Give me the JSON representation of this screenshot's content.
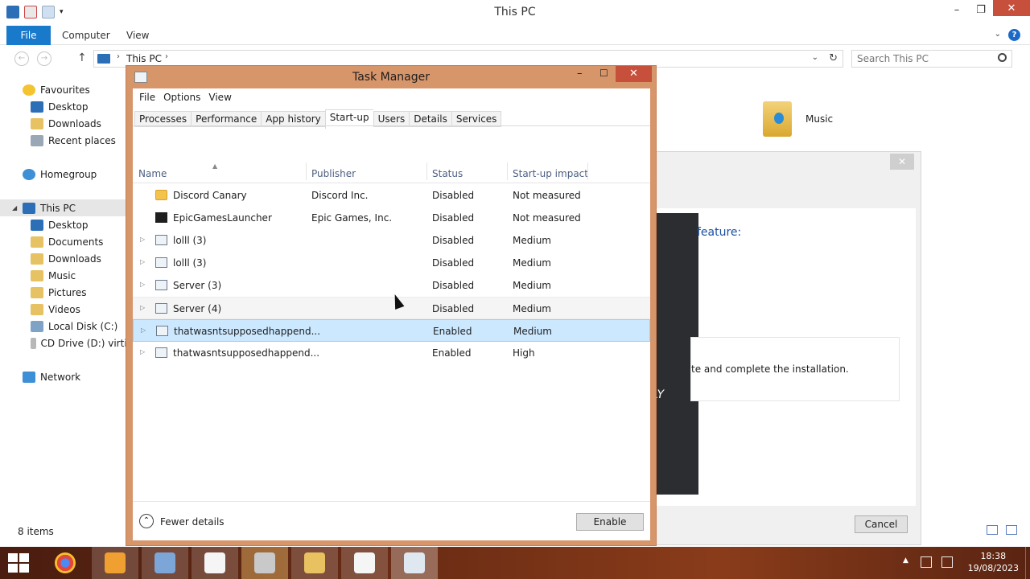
{
  "explorer": {
    "title": "This PC",
    "ribbon_tabs": [
      "File",
      "Computer",
      "View"
    ],
    "address": {
      "crumb": "This PC"
    },
    "search": {
      "placeholder": "Search This PC"
    },
    "status": "8 items",
    "nav": {
      "favourites": "Favourites",
      "fav_items": [
        "Desktop",
        "Downloads",
        "Recent places"
      ],
      "homegroup": "Homegroup",
      "this_pc": "This PC",
      "pc_items": [
        "Desktop",
        "Documents",
        "Downloads",
        "Music",
        "Pictures",
        "Videos",
        "Local Disk (C:)",
        "CD Drive (D:) virtio"
      ],
      "network": "Network"
    },
    "content": {
      "music_label": "Music"
    }
  },
  "installer": {
    "feature_text": "feature:",
    "body_text": "te and complete the installation.",
    "dark_text": "LY",
    "cancel_label": "Cancel"
  },
  "task_manager": {
    "title": "Task Manager",
    "menu": [
      "File",
      "Options",
      "View"
    ],
    "tabs": [
      "Processes",
      "Performance",
      "App history",
      "Start-up",
      "Users",
      "Details",
      "Services"
    ],
    "active_tab": "Start-up",
    "columns": [
      "Name",
      "Publisher",
      "Status",
      "Start-up impact"
    ],
    "rows": [
      {
        "name": "Discord Canary",
        "publisher": "Discord Inc.",
        "status": "Disabled",
        "impact": "Not measured"
      },
      {
        "name": "EpicGamesLauncher",
        "publisher": "Epic Games, Inc.",
        "status": "Disabled",
        "impact": "Not measured"
      },
      {
        "name": "lolll (3)",
        "publisher": "",
        "status": "Disabled",
        "impact": "Medium"
      },
      {
        "name": "lolll (3)",
        "publisher": "",
        "status": "Disabled",
        "impact": "Medium"
      },
      {
        "name": "Server (3)",
        "publisher": "",
        "status": "Disabled",
        "impact": "Medium"
      },
      {
        "name": "Server (4)",
        "publisher": "",
        "status": "Disabled",
        "impact": "Medium"
      },
      {
        "name": "thatwasntsupposedhappend...",
        "publisher": "",
        "status": "Enabled",
        "impact": "Medium"
      },
      {
        "name": "thatwasntsupposedhappend...",
        "publisher": "",
        "status": "Enabled",
        "impact": "High"
      }
    ],
    "fewer_details": "Fewer details",
    "enable_label": "Enable"
  },
  "taskbar": {
    "time": "18:38",
    "date": "19/08/2023"
  },
  "colors": {
    "accent": "#1979ca",
    "tm_frame": "#d7956a",
    "close_red": "#c7503d",
    "selection": "#cce8ff"
  }
}
